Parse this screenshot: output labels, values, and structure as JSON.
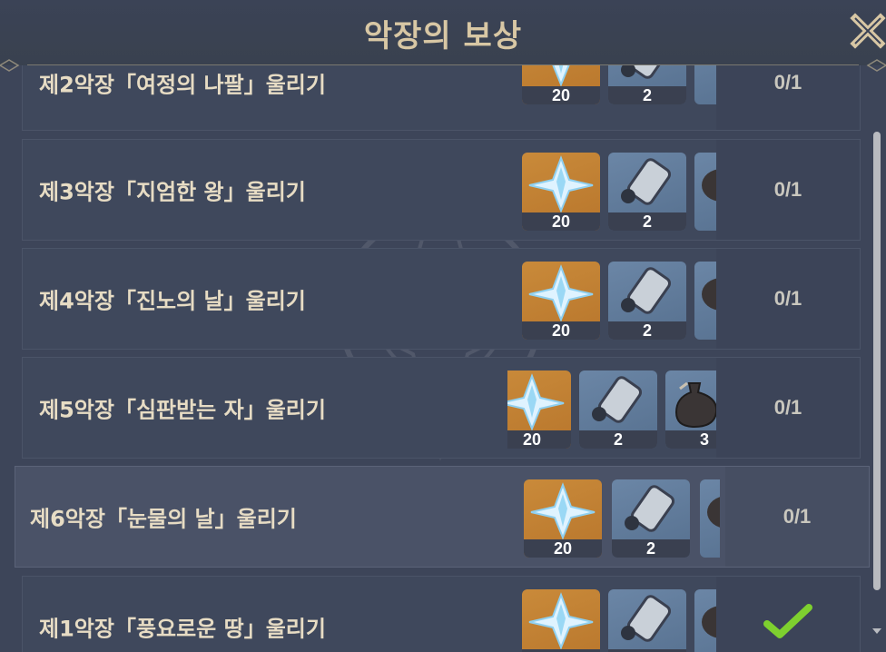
{
  "header": {
    "title": "악장의 보상"
  },
  "icons": {
    "close": "close-x-icon",
    "complete": "checkmark-icon",
    "primogem": "primogem-icon",
    "scroll": "hero-wit-scroll-icon",
    "bottle": "mora-bottle-icon"
  },
  "colors": {
    "title": "#d8c7a4",
    "label": "#e7dcc4",
    "gold_bg": "#c98a3a",
    "blue_bg": "#6b86a6",
    "check": "#7ed02f"
  },
  "rows": [
    {
      "label": "제2악장「여정의 나팔」울리기",
      "rewards": [
        "20",
        "2",
        ""
      ],
      "progress": "0/1"
    },
    {
      "label": "제3악장「지엄한 왕」울리기",
      "rewards": [
        "20",
        "2",
        ""
      ],
      "progress": "0/1"
    },
    {
      "label": "제4악장「진노의 날」울리기",
      "rewards": [
        "20",
        "2",
        ""
      ],
      "progress": "0/1"
    },
    {
      "label": "제5악장「심판받는 자」울리기",
      "rewards": [
        "20",
        "2",
        "3"
      ],
      "progress": "0/1"
    },
    {
      "label": "제6악장「눈물의 날」울리기",
      "rewards": [
        "20",
        "2",
        ""
      ],
      "progress": "0/1",
      "selected": true
    },
    {
      "label": "제1악장「풍요로운 땅」울리기",
      "rewards": [
        "20",
        "2",
        ""
      ],
      "progress": "",
      "completed": true
    }
  ]
}
